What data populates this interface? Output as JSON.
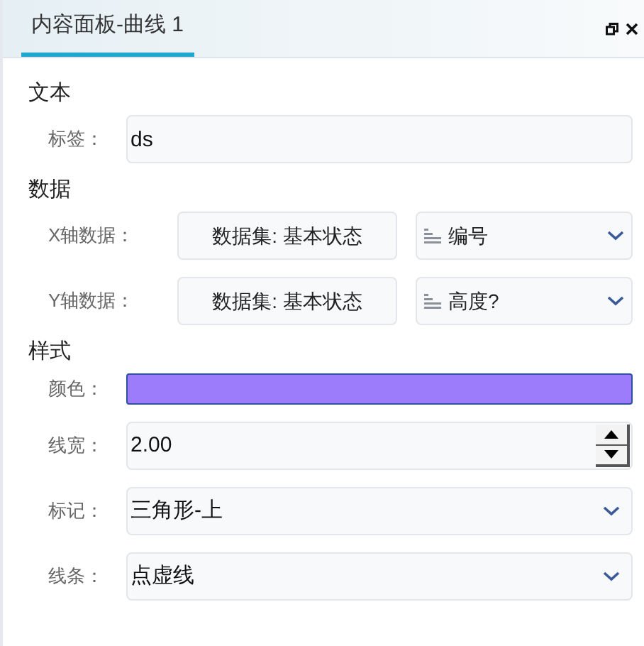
{
  "panel": {
    "title": "内容面板-曲线 1"
  },
  "sections": [
    {
      "title": "文本",
      "rows": [
        {
          "kind": "text",
          "label": "标签：",
          "value": "ds"
        }
      ]
    },
    {
      "title": "数据",
      "rows": [
        {
          "kind": "data",
          "label": "X轴数据：",
          "dataset": "数据集: 基本状态",
          "field": "编号"
        },
        {
          "kind": "data",
          "label": "Y轴数据：",
          "dataset": "数据集: 基本状态",
          "field": "高度?"
        }
      ]
    },
    {
      "title": "样式",
      "rows": [
        {
          "kind": "color",
          "label": "颜色：",
          "color": "#9d7cfb"
        },
        {
          "kind": "number",
          "label": "线宽：",
          "value": "2.00"
        },
        {
          "kind": "select",
          "label": "标记：",
          "value": "三角形-上"
        },
        {
          "kind": "select",
          "label": "线条：",
          "value": "点虚线"
        }
      ]
    }
  ]
}
